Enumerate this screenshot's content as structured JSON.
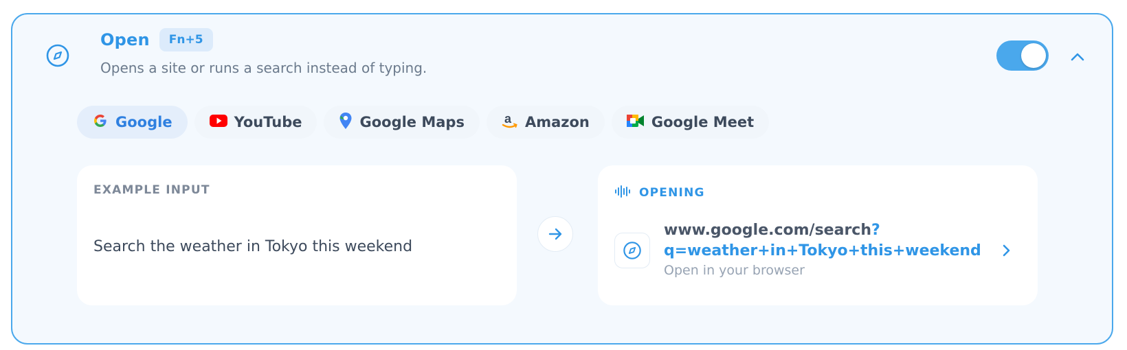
{
  "header": {
    "title": "Open",
    "shortcut": "Fn+5",
    "subtitle": "Opens a site or runs a search instead of typing.",
    "icon": "compass-icon",
    "enabled": true
  },
  "chips": [
    {
      "label": "Google",
      "icon": "google-icon",
      "active": true
    },
    {
      "label": "YouTube",
      "icon": "youtube-icon",
      "active": false
    },
    {
      "label": "Google Maps",
      "icon": "google-maps-icon",
      "active": false
    },
    {
      "label": "Amazon",
      "icon": "amazon-icon",
      "active": false
    },
    {
      "label": "Google Meet",
      "icon": "google-meet-icon",
      "active": false
    }
  ],
  "example": {
    "label": "EXAMPLE INPUT",
    "text": "Search the weather in Tokyo this weekend"
  },
  "opening": {
    "label": "OPENING",
    "url_base": "www.google.com/search",
    "url_query": "?q=weather+in+Tokyo+this+weekend",
    "hint": "Open in your browser"
  },
  "colors": {
    "accent": "#2f95e6",
    "border": "#4aa8ec",
    "card_bg": "#f4f9fe"
  }
}
